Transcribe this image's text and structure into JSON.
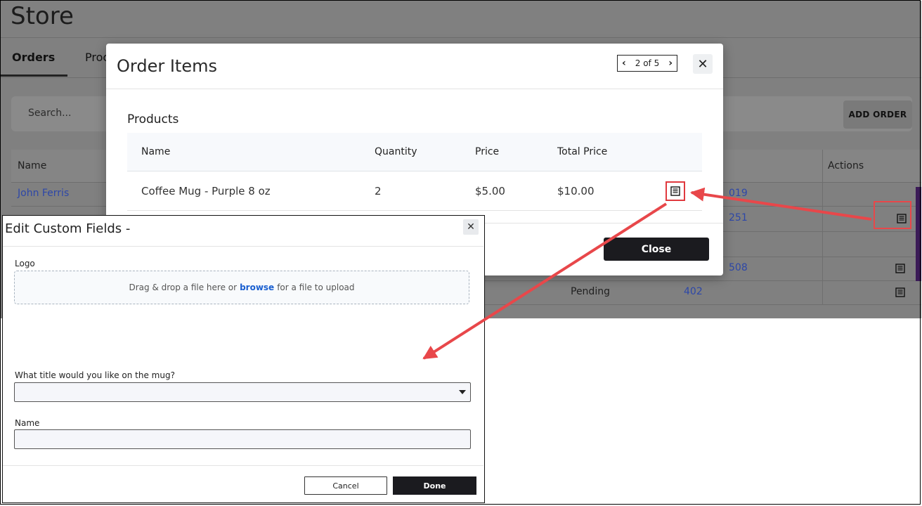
{
  "store": {
    "title": "Store",
    "tabs": [
      "Orders",
      "Proc"
    ],
    "search_placeholder": "Search...",
    "add_order_label": "ADD ORDER",
    "columns": {
      "name": "Name",
      "actions": "Actions"
    },
    "rows": [
      {
        "name": "John Ferris",
        "id": "019"
      },
      {
        "name": "",
        "id": "251"
      },
      {
        "name": "",
        "id": ""
      },
      {
        "name": "",
        "id": "508"
      },
      {
        "name": "",
        "status": "Pending",
        "id": "402"
      }
    ]
  },
  "order_modal": {
    "title": "Order Items",
    "pager": "2 of 5",
    "section": "Products",
    "headers": [
      "Name",
      "Quantity",
      "Price",
      "Total Price"
    ],
    "items": [
      {
        "name": "Coffee Mug - Purple 8 oz",
        "quantity": "2",
        "price": "$5.00",
        "total": "$10.00"
      }
    ],
    "close_label": "Close"
  },
  "edit_dialog": {
    "title": "Edit Custom Fields -",
    "logo_label": "Logo",
    "dropzone_before": "Drag & drop a file here or",
    "dropzone_link": "browse",
    "dropzone_after": "for a file to upload",
    "mug_title_label": "What title would you like on the mug?",
    "mug_title_value": "",
    "name_label": "Name",
    "name_value": "",
    "cancel_label": "Cancel",
    "done_label": "Done"
  },
  "colors": {
    "callout": "#e8474a",
    "primary_button": "#1b1b1f",
    "link": "#1a5fd0"
  },
  "icons": [
    "document-list-icon",
    "close-icon",
    "chevron-left-icon",
    "chevron-right-icon",
    "caret-down-icon"
  ]
}
